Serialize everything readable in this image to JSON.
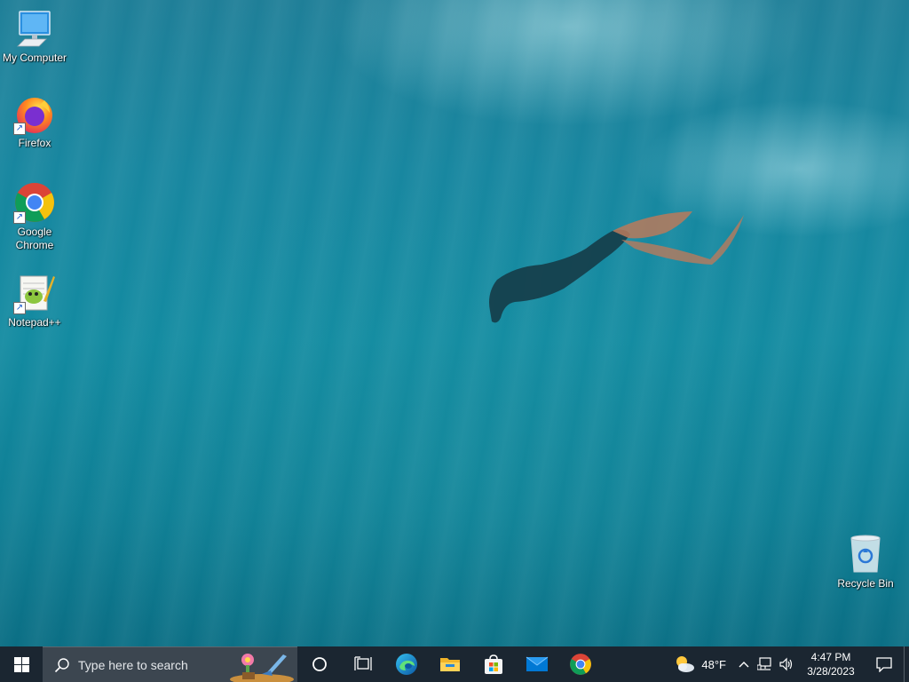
{
  "desktop": {
    "icons": [
      {
        "label": "My Computer",
        "icon": "monitor-icon"
      },
      {
        "label": "Firefox",
        "icon": "firefox-icon"
      },
      {
        "label": "Google Chrome",
        "icon": "chrome-icon"
      },
      {
        "label": "Notepad++",
        "icon": "notepadpp-icon"
      },
      {
        "label": "Recycle Bin",
        "icon": "recycle-bin-icon"
      }
    ]
  },
  "taskbar": {
    "search_placeholder": "Type here to search",
    "apps": [
      "cortana-icon",
      "task-view-icon",
      "edge-icon",
      "file-explorer-icon",
      "microsoft-store-icon",
      "mail-icon",
      "chrome-icon"
    ],
    "weather": {
      "temp": "48°F",
      "icon": "partly-cloudy-icon"
    },
    "clock": {
      "time": "4:47 PM",
      "date": "3/28/2023"
    }
  },
  "colors": {
    "taskbar_bg": "#1b2631",
    "search_bg": "#3c4650",
    "accent_blue": "#0078d4"
  }
}
